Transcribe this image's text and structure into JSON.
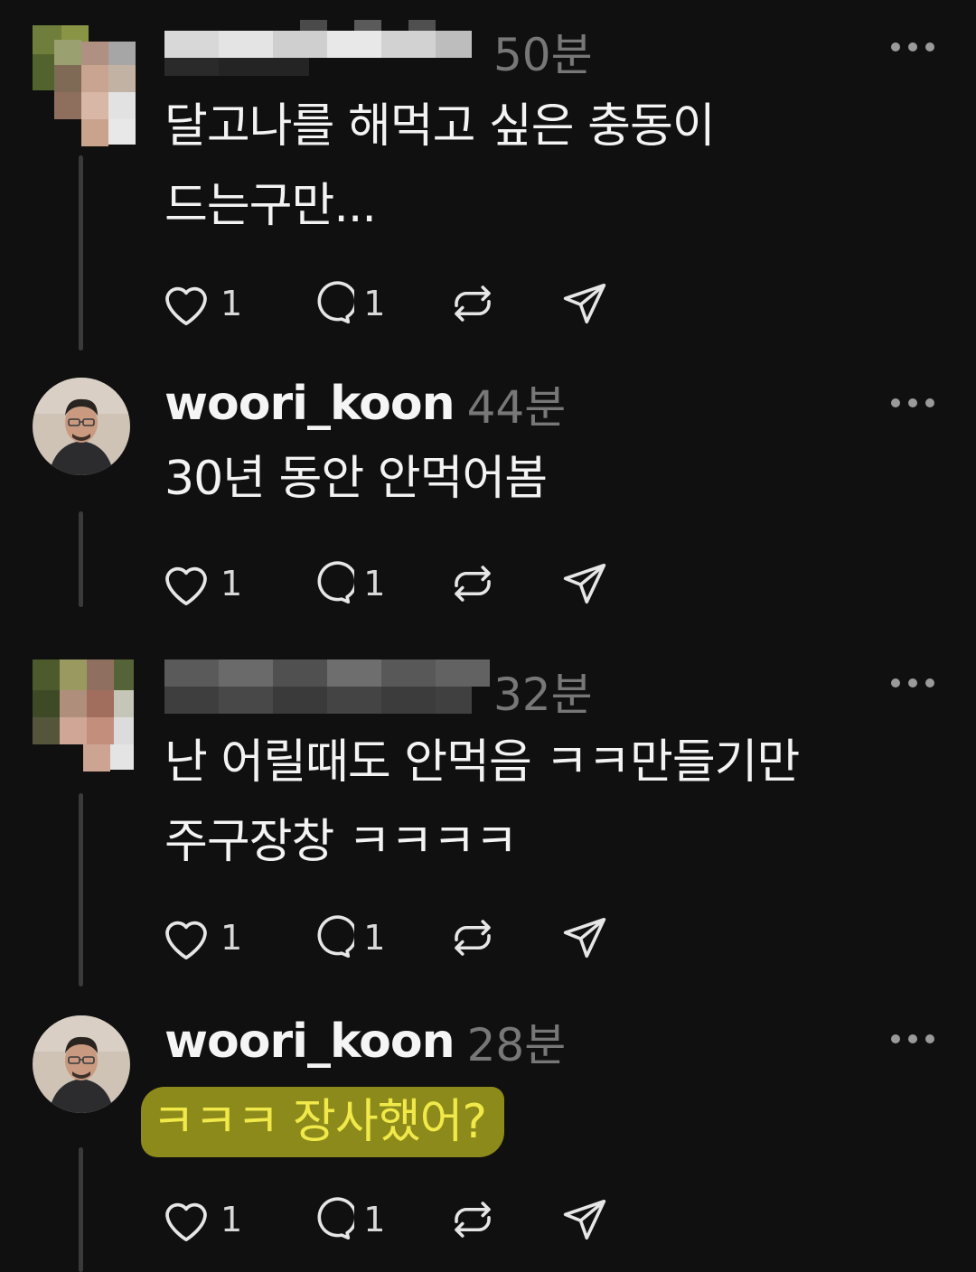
{
  "posts": [
    {
      "username": "",
      "time": "50분",
      "text_lines": [
        "달고나를 해먹고 싶은 충동이",
        "드는구만..."
      ],
      "likes": "1",
      "replies": "1",
      "redacted": true
    },
    {
      "username": "woori_koon",
      "time": "44분",
      "text_lines": [
        "30년 동안 안먹어봄"
      ],
      "likes": "1",
      "replies": "1",
      "redacted": false
    },
    {
      "username": "",
      "time": "32분",
      "text_lines": [
        "난 어릴때도 안먹음 ㅋㅋ만들기만",
        "주구장창 ㅋㅋㅋㅋ"
      ],
      "likes": "1",
      "replies": "1",
      "redacted": true
    },
    {
      "username": "woori_koon",
      "time": "28분",
      "text_lines": [
        "ㅋㅋㅋ 장사했어?"
      ],
      "likes": "1",
      "replies": "1",
      "redacted": false,
      "highlighted": true
    }
  ],
  "icons": {
    "like": "heart-icon",
    "reply": "speech-bubble-icon",
    "repost": "repost-icon",
    "share": "send-icon",
    "more": "more-options-icon"
  },
  "colors": {
    "background": "#101010",
    "text": "#f3f3f3",
    "muted": "#777777",
    "highlight_bg": "#8c8a1a",
    "highlight_text": "#f1e94a"
  }
}
